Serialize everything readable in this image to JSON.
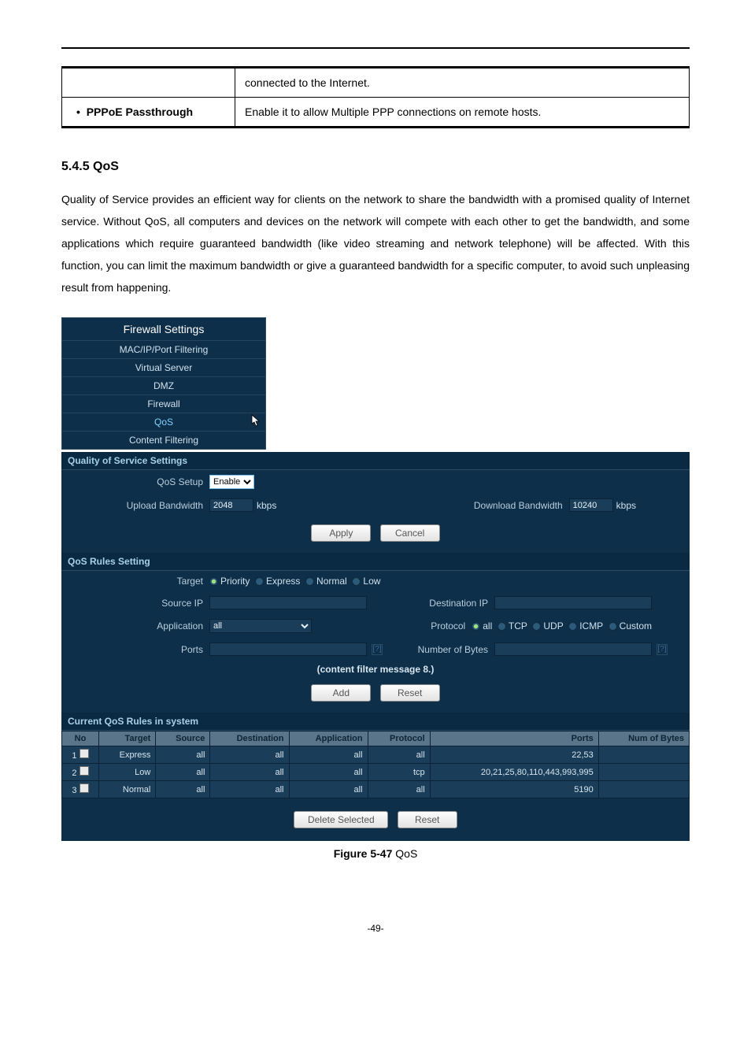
{
  "feature_table": {
    "row1_right": "connected to the Internet.",
    "row2_left": "PPPoE Passthrough",
    "row2_right": "Enable it to allow Multiple PPP connections on remote hosts."
  },
  "section_heading": "5.4.5  QoS",
  "body_paragraph": "Quality of Service provides an efficient way for clients on the network to share the bandwidth with a promised quality of Internet service. Without QoS, all computers and devices on the network will compete with each other to get the bandwidth, and some applications which require guaranteed bandwidth (like video streaming and network telephone) will be affected. With this function, you can limit the maximum bandwidth or give a guaranteed bandwidth for a specific computer, to avoid such unpleasing result from happening.",
  "nav": {
    "title": "Firewall Settings",
    "items": [
      "MAC/IP/Port Filtering",
      "Virtual Server",
      "DMZ",
      "Firewall",
      "QoS",
      "Content Filtering"
    ],
    "active_index": 4
  },
  "qos_settings": {
    "header": "Quality of Service Settings",
    "setup_label": "QoS Setup",
    "setup_value": "Enable",
    "upload_label": "Upload Bandwidth",
    "upload_value": "2048",
    "download_label": "Download Bandwidth",
    "download_value": "10240",
    "unit": "kbps",
    "apply_btn": "Apply",
    "cancel_btn": "Cancel"
  },
  "rules_setting": {
    "header": "QoS Rules Setting",
    "target_label": "Target",
    "targets": [
      "Priority",
      "Express",
      "Normal",
      "Low"
    ],
    "source_ip_label": "Source IP",
    "dest_ip_label": "Destination IP",
    "application_label": "Application",
    "application_value": "all",
    "protocol_label": "Protocol",
    "protocols": [
      "all",
      "TCP",
      "UDP",
      "ICMP",
      "Custom"
    ],
    "ports_label": "Ports",
    "numbytes_label": "Number of Bytes",
    "help_hint": "[?]",
    "content_msg": "(content filter message 8.)",
    "add_btn": "Add",
    "reset_btn": "Reset"
  },
  "current_rules": {
    "header": "Current QoS Rules in system",
    "columns": [
      "No",
      "Target",
      "Source",
      "Destination",
      "Application",
      "Protocol",
      "Ports",
      "Num of Bytes"
    ],
    "rows": [
      {
        "no": "1",
        "target": "Express",
        "source": "all",
        "destination": "all",
        "application": "all",
        "protocol": "all",
        "ports": "22,53",
        "numbytes": ""
      },
      {
        "no": "2",
        "target": "Low",
        "source": "all",
        "destination": "all",
        "application": "all",
        "protocol": "tcp",
        "ports": "20,21,25,80,110,443,993,995",
        "numbytes": ""
      },
      {
        "no": "3",
        "target": "Normal",
        "source": "all",
        "destination": "all",
        "application": "all",
        "protocol": "all",
        "ports": "5190",
        "numbytes": ""
      }
    ],
    "delete_btn": "Delete Selected",
    "reset_btn": "Reset"
  },
  "figure_caption_bold": "Figure 5-47",
  "figure_caption_rest": " QoS",
  "page_number": "-49-"
}
